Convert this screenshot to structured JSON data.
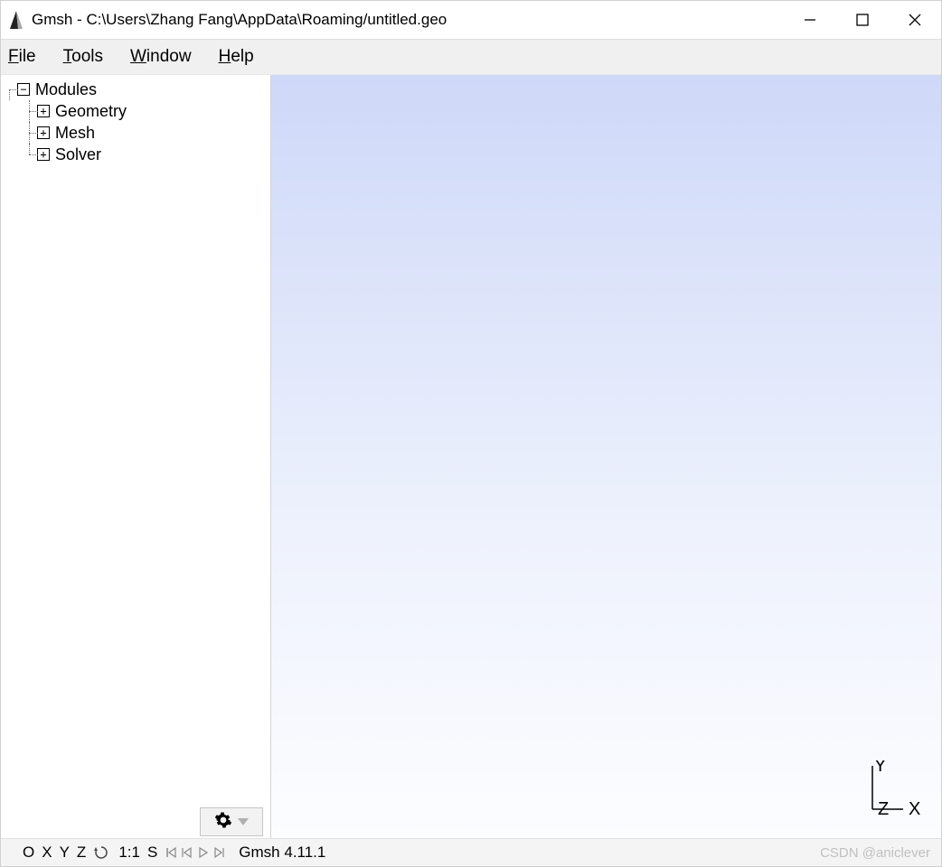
{
  "title": "Gmsh - C:\\Users\\Zhang Fang\\AppData\\Roaming/untitled.geo",
  "menu": {
    "file": "File",
    "tools": "Tools",
    "window": "Window",
    "help": "Help"
  },
  "tree": {
    "root": "Modules",
    "items": [
      "Geometry",
      "Mesh",
      "Solver"
    ]
  },
  "viewport": {
    "axis_x": "X",
    "axis_y": "Y",
    "axis_z": "Z"
  },
  "status": {
    "btn_o": "O",
    "btn_x": "X",
    "btn_y": "Y",
    "btn_z": "Z",
    "ratio": "1:1",
    "s": "S",
    "version": "Gmsh 4.11.1"
  },
  "watermark": "CSDN @aniclever"
}
